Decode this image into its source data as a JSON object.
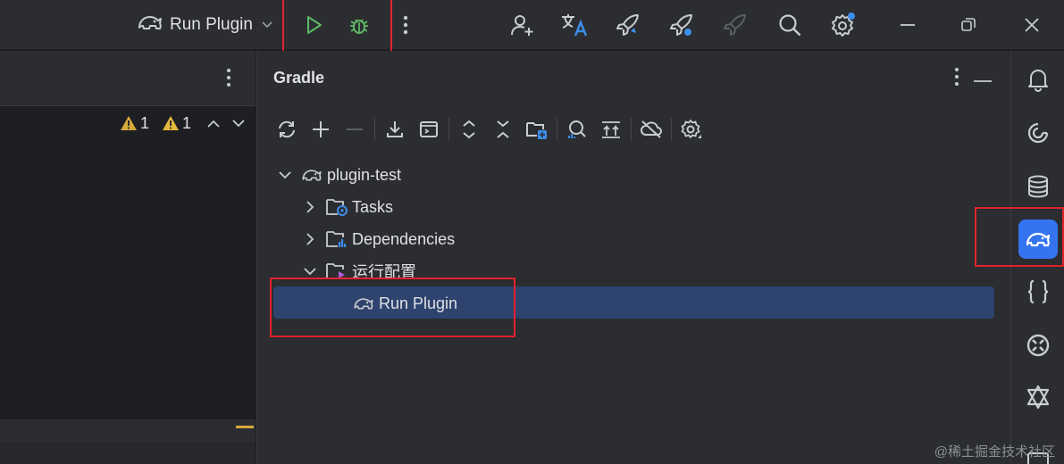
{
  "titlebar": {
    "run_config_label": "Run Plugin",
    "run_config_icon": "gradle-elephant-icon",
    "buttons": [
      "run-icon",
      "debug-icon",
      "more-icon",
      "add-user-icon",
      "translate-icon",
      "rocket-icon",
      "rocket-debug-icon",
      "rocket-disabled-icon",
      "search-icon",
      "settings-icon",
      "minimize-icon",
      "restore-icon",
      "close-icon"
    ]
  },
  "editor": {
    "warning_count_1": "1",
    "warning_count_2": "1"
  },
  "gradle": {
    "title": "Gradle",
    "toolbar": [
      "reload-icon",
      "add-icon",
      "remove-icon",
      "download-icon",
      "script-icon",
      "expand-all-icon",
      "collapse-all-icon",
      "link-project-icon",
      "analyze-icon",
      "align-icon",
      "offline-icon",
      "gradle-settings-icon"
    ],
    "tree": [
      {
        "label": "plugin-test",
        "icon": "gradle-elephant-icon",
        "expanded": true
      },
      {
        "label": "Tasks",
        "icon": "tasks-folder-icon",
        "expanded": false
      },
      {
        "label": "Dependencies",
        "icon": "dependencies-folder-icon",
        "expanded": false
      },
      {
        "label": "运行配置",
        "icon": "run-configs-folder-icon",
        "expanded": true
      },
      {
        "label": "Run Plugin",
        "icon": "gradle-elephant-icon",
        "selected": true
      }
    ]
  },
  "right_strip": [
    "notifications-icon",
    "ai-assistant-icon",
    "database-icon",
    "gradle-icon",
    "json-icon",
    "plugin-icon",
    "ai-tool-icon"
  ],
  "colors": {
    "accent": "#3574f0",
    "selection": "#2e436e",
    "run_green": "#5fb865",
    "highlight_red": "#e1232b",
    "warning": "#d6a93a"
  },
  "watermark": "@稀土掘金技术社区"
}
